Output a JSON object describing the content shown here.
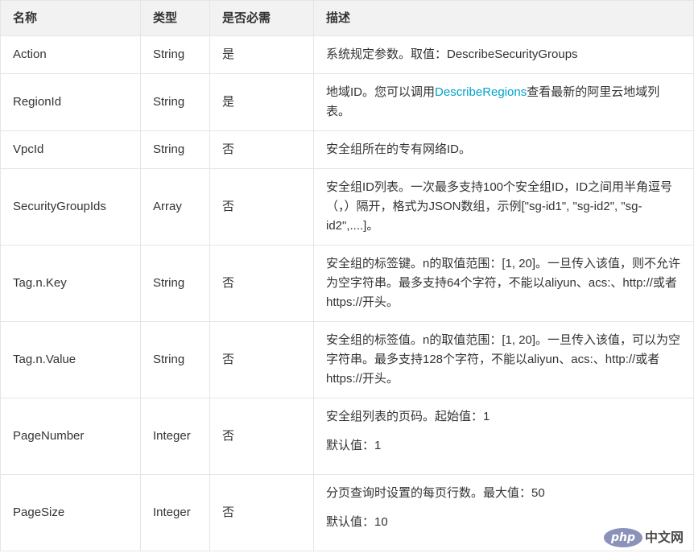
{
  "table": {
    "headers": {
      "name": "名称",
      "type": "类型",
      "required": "是否必需",
      "description": "描述"
    },
    "rows": [
      {
        "name": "Action",
        "type": "String",
        "required": "是",
        "description": [
          "系统规定参数。取值：DescribeSecurityGroups"
        ]
      },
      {
        "name": "RegionId",
        "type": "String",
        "required": "是",
        "description": [
          {
            "before": "地域ID。您可以调用",
            "link": "DescribeRegions",
            "after": "查看最新的阿里云地域列表。"
          }
        ]
      },
      {
        "name": "VpcId",
        "type": "String",
        "required": "否",
        "description": [
          "安全组所在的专有网络ID。"
        ]
      },
      {
        "name": "SecurityGroupIds",
        "type": "Array",
        "required": "否",
        "description": [
          "安全组ID列表。一次最多支持100个安全组ID，ID之间用半角逗号（，）隔开，格式为JSON数组，示例[\"sg-id1\", \"sg-id2\", \"sg-id2\",....]。"
        ]
      },
      {
        "name": "Tag.n.Key",
        "type": "String",
        "required": "否",
        "description": [
          "安全组的标签键。n的取值范围：[1, 20]。一旦传入该值，则不允许为空字符串。最多支持64个字符，不能以aliyun、acs:、http://或者https://开头。"
        ]
      },
      {
        "name": "Tag.n.Value",
        "type": "String",
        "required": "否",
        "description": [
          "安全组的标签值。n的取值范围：[1, 20]。一旦传入该值，可以为空字符串。最多支持128个字符，不能以aliyun、acs:、http://或者https://开头。"
        ]
      },
      {
        "name": "PageNumber",
        "type": "Integer",
        "required": "否",
        "description": [
          "安全组列表的页码。起始值：1",
          "默认值：1"
        ]
      },
      {
        "name": "PageSize",
        "type": "Integer",
        "required": "否",
        "description": [
          "分页查询时设置的每页行数。最大值：50",
          "默认值：10"
        ]
      }
    ]
  },
  "colors": {
    "text": "#333333",
    "header_background": "#f2f2f2",
    "border": "#e5e5e5",
    "link": "#00a2ca",
    "watermark_logo": "#8a92b9",
    "watermark_text": "#4a4a4a"
  },
  "watermark": {
    "logo_text": "php",
    "site_text": "中文网"
  }
}
